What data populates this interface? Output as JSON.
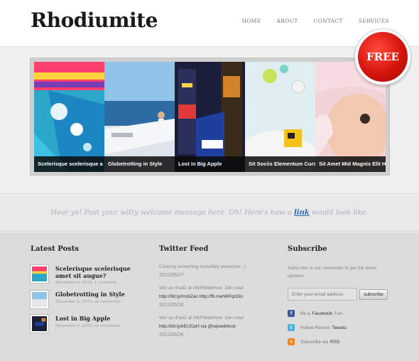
{
  "header": {
    "logo": "Rhodiumite",
    "nav": [
      "HOME",
      "ABOUT",
      "CONTACT",
      "SERVICES"
    ]
  },
  "badge": {
    "label": "FREE"
  },
  "slider": {
    "captions": [
      "Scelerisque scelerisque a",
      "Globetrotting in Style",
      "Lost in Big Apple",
      "Sit Sociis Elementum Curs",
      "Sit Amet Mid Magnis Elit H"
    ]
  },
  "welcome": {
    "before": "Hear ye! Post your witty welcome message here. Oh! Here's how a ",
    "link": "link",
    "after": " would look like."
  },
  "latest_posts": {
    "heading": "Latest Posts",
    "items": [
      {
        "title": "Scelerisque scelerisque amet sit augue?",
        "meta": "December 6, 2010, 1 comment"
      },
      {
        "title": "Globetrotting in Style",
        "meta": "December 6, 2010, no comments"
      },
      {
        "title": "Lost in Big Apple",
        "meta": "December 6, 2010, no comments"
      }
    ]
  },
  "twitter": {
    "heading": "Twitter Feed",
    "tweets": [
      {
        "text": "Cooking something incredibly awesome. :)",
        "link": "",
        "date": "2011/05/27"
      },
      {
        "text": "Win an iPad2 at #WPWebHost. Join now!",
        "link": "http://bit.ly/msbZan http://fb.me/WPqzDin",
        "date": "2011/05/26"
      },
      {
        "text": "Win an iPad2 at #WPWebHost. Join now!",
        "link": "http://bit.ly/kEUCpH via @wpwebhost",
        "date": "2011/05/26"
      }
    ]
  },
  "subscribe": {
    "heading": "Subscribe",
    "text": "Subscribe to our newsletter to get the latest updates.",
    "placeholder": "Enter your email address",
    "button": "subscribe",
    "links": [
      {
        "icon": "facebook-icon",
        "pre": "Be a",
        "strong": "Facebook",
        "post": "Fan",
        "color": "#3b5998"
      },
      {
        "icon": "twitter-icon",
        "pre": "Follow Recent",
        "strong": "Tweets",
        "post": "",
        "color": "#4ab3e0"
      },
      {
        "icon": "rss-icon",
        "pre": "Subscribe via",
        "strong": "RSS",
        "post": "",
        "color": "#f08a1c"
      }
    ]
  }
}
